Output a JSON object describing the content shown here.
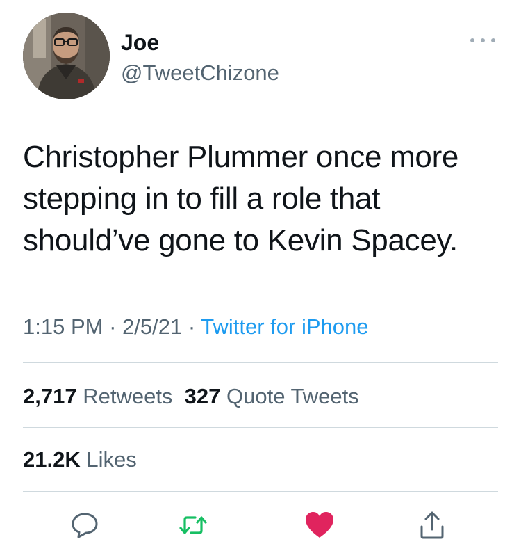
{
  "user": {
    "name": "Joe",
    "handle": "@TweetChizone"
  },
  "tweet": {
    "text": "Christopher Plummer once more\nstepping in to fill a role that\nshould’ve gone to Kevin Spacey.",
    "time": "1:15 PM",
    "separator": "·",
    "date": "2/5/21",
    "source": "Twitter for iPhone"
  },
  "stats": {
    "retweets_count": "2,717",
    "retweets_label": "Retweets",
    "quotes_count": "327",
    "quotes_label": "Quote Tweets",
    "likes_count": "21.2K",
    "likes_label": "Likes"
  },
  "actions": [
    {
      "icon": "reply-icon"
    },
    {
      "icon": "retweet-icon",
      "color": "#17bf63"
    },
    {
      "icon": "heart-icon",
      "color": "#e0245e"
    },
    {
      "icon": "share-icon"
    }
  ],
  "colors": {
    "accent": "#1d9bf0",
    "secondary_text": "#536471",
    "like_active": "#e0245e",
    "retweet_active": "#17bf63"
  }
}
